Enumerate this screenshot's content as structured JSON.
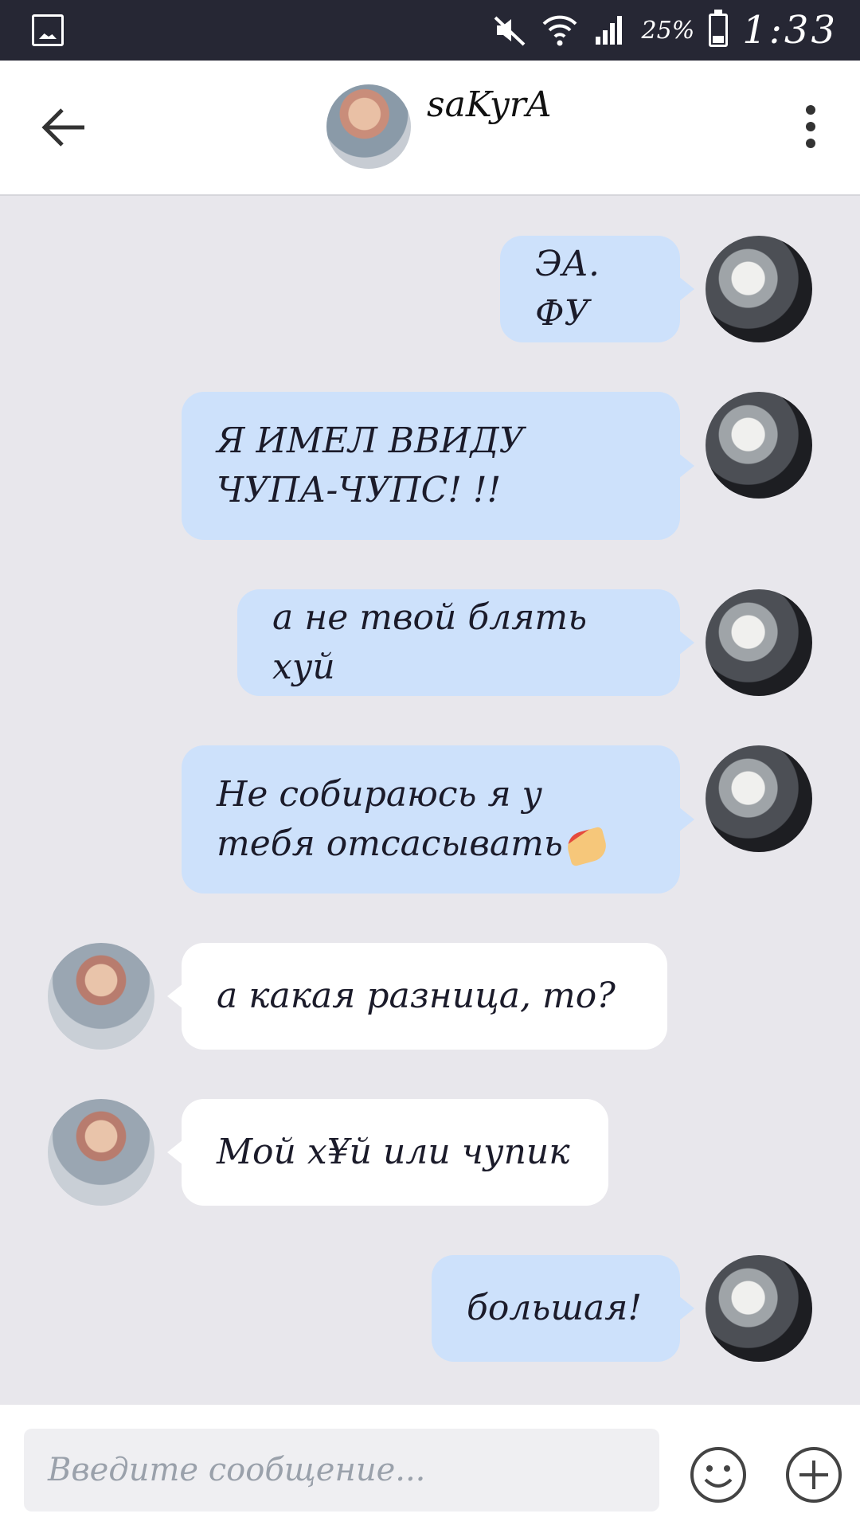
{
  "status_bar": {
    "icons": [
      "gallery-icon",
      "mute-icon",
      "wifi-icon",
      "signal-icon",
      "battery-icon"
    ],
    "battery_text": "25%",
    "time": "1:33"
  },
  "header": {
    "contact_name": "saKyrA"
  },
  "messages": [
    {
      "side": "out",
      "text": "ЭА. ФУ"
    },
    {
      "side": "out",
      "text": "Я ИМЕЛ ВВИДУ ЧУПА-ЧУПС! !!"
    },
    {
      "side": "out",
      "text": "а не твой блять хуй"
    },
    {
      "side": "out",
      "text": "Не собираюсь я у тебя отсасывать"
    },
    {
      "side": "in",
      "text": "а какая разница, то?"
    },
    {
      "side": "in",
      "text": "Мой х¥й или чупик"
    },
    {
      "side": "out",
      "text": "большая!"
    }
  ],
  "composer": {
    "placeholder": "Введите сообщение..."
  },
  "colors": {
    "status_bar": "#262734",
    "chat_bg": "#e8e7ec",
    "outgoing_bubble": "#cde1fb",
    "incoming_bubble": "#ffffff"
  }
}
